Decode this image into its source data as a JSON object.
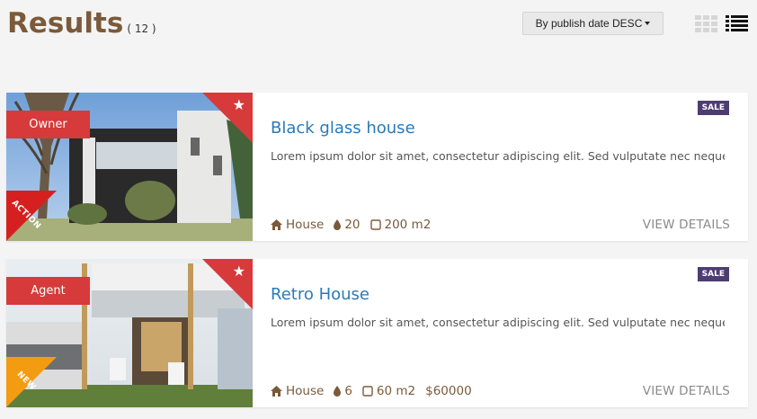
{
  "header": {
    "title": "Results",
    "count": "( 12 )"
  },
  "sort": {
    "label": "By publish date DESC"
  },
  "colors": {
    "accent": "#d63a3a",
    "brand": "#7a5a3a",
    "link": "#2a7ab8",
    "badge": "#4e3d72",
    "action_tag": "#d62020",
    "new_tag": "#f39c12"
  },
  "listings": [
    {
      "owner_label": "Owner",
      "corner_tag": "ACTION",
      "badge": "SALE",
      "title": "Black glass house",
      "description": "Lorem ipsum dolor sit amet, consectetur adipiscing elit. Sed vulputate nec neque...",
      "type": "House",
      "rooms": "20",
      "area": "200 m2",
      "price": "",
      "action": "VIEW DETAILS"
    },
    {
      "owner_label": "Agent",
      "corner_tag": "NEW",
      "badge": "SALE",
      "title": "Retro House",
      "description": "Lorem ipsum dolor sit amet, consectetur adipiscing elit. Sed vulputate nec neque...",
      "type": "House",
      "rooms": "6",
      "area": "60 m2",
      "price": "$60000",
      "action": "VIEW DETAILS"
    }
  ]
}
